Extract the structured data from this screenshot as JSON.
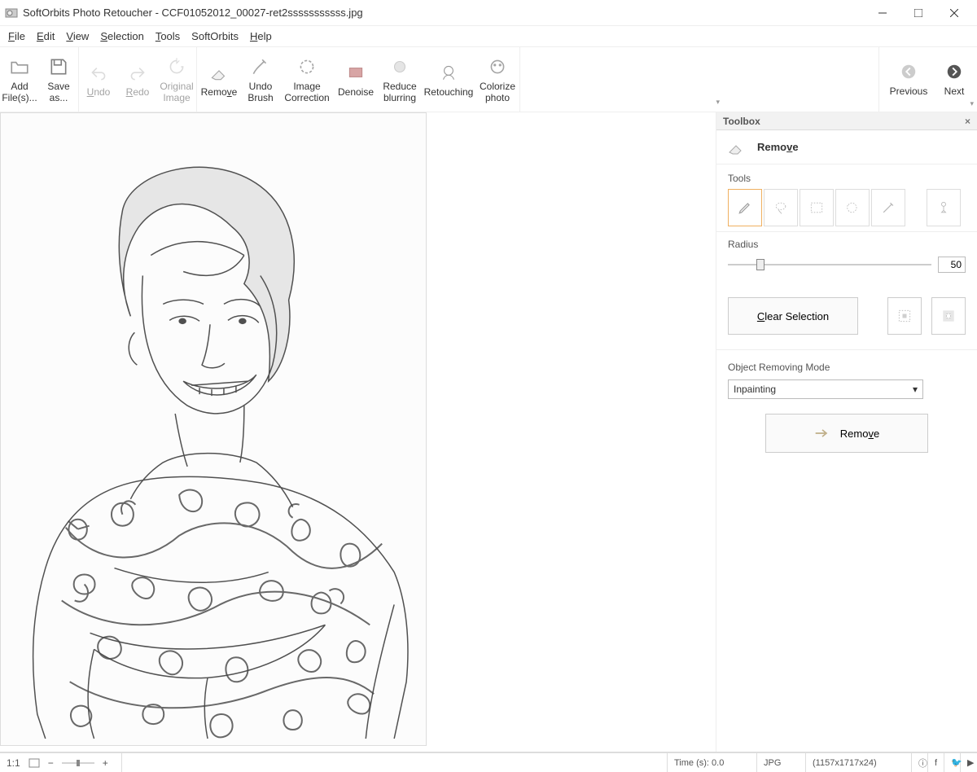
{
  "window": {
    "title": "SoftOrbits Photo Retoucher - CCF01052012_00027-ret2sssssssssss.jpg"
  },
  "menu": {
    "file": "File",
    "edit": "Edit",
    "view": "View",
    "selection": "Selection",
    "tools": "Tools",
    "softorbits": "SoftOrbits",
    "help": "Help"
  },
  "toolbar": {
    "add": "Add File(s)...",
    "save": "Save as...",
    "undo": "Undo",
    "redo": "Redo",
    "original": "Original Image",
    "remove": "Remove",
    "undobrush": "Undo Brush",
    "imagecorr": "Image Correction",
    "denoise": "Denoise",
    "reduceblur": "Reduce blurring",
    "retouching": "Retouching",
    "colorize": "Colorize photo",
    "previous": "Previous",
    "next": "Next"
  },
  "toolbox": {
    "title": "Toolbox",
    "remove_label": "Remove",
    "tools_label": "Tools",
    "radius_label": "Radius",
    "radius_value": "50",
    "clear_label": "Clear Selection",
    "mode_label": "Object Removing Mode",
    "mode_value": "Inpainting",
    "big_remove": "Remove"
  },
  "status": {
    "ratio": "1:1",
    "time": "Time (s): 0.0",
    "format": "JPG",
    "dims": "(1157x1717x24)"
  }
}
